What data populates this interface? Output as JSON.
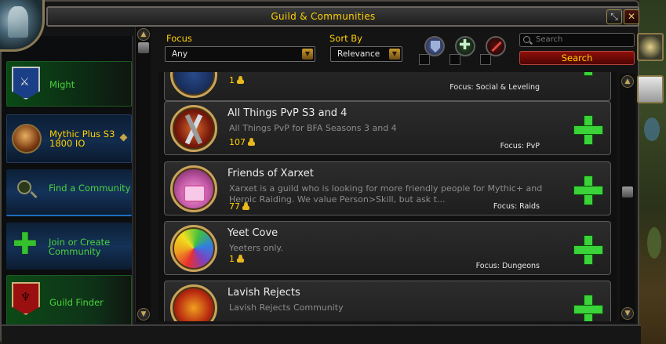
{
  "window": {
    "title": "Guild & Communities"
  },
  "sidebar": {
    "items": [
      {
        "label": "Might",
        "color": "#4bd33b"
      },
      {
        "label": "Mythic Plus S3",
        "sub": "1800 IO",
        "color": "#ffd100"
      },
      {
        "label": "Find a Community",
        "color": "#4bd33b"
      },
      {
        "label": "Join or Create Community",
        "color": "#4bd33b"
      },
      {
        "label": "Guild Finder",
        "color": "#4bd33b"
      }
    ]
  },
  "filters": {
    "focus_label": "Focus",
    "focus_value": "Any",
    "sort_label": "Sort By",
    "sort_value": "Relevance",
    "search_placeholder": "Search",
    "search_button": "Search",
    "roles": [
      "tank-icon",
      "healer-icon",
      "damage-icon"
    ]
  },
  "results": [
    {
      "name": "",
      "desc": "",
      "members": "1",
      "focus": "Focus: Social & Leveling"
    },
    {
      "name": "All Things PvP S3 and 4",
      "desc": "All Things PvP for BFA Seasons 3 and 4",
      "members": "107",
      "focus": "Focus: PvP"
    },
    {
      "name": "Friends of Xarxet",
      "desc": "Xarxet is a guild who is looking for more friendly people for Mythic+ and Heroic Raiding. We value Person>Skill, but ask t...",
      "members": "77",
      "focus": "Focus: Raids"
    },
    {
      "name": "Yeet Cove",
      "desc": "Yeeters only.",
      "members": "1",
      "focus": "Focus: Dungeons"
    },
    {
      "name": "Lavish Rejects",
      "desc": "Lavish Rejects Community",
      "members": "",
      "focus": ""
    }
  ],
  "colors": {
    "accent_gold": "#ffd100",
    "accent_green": "#3ad33a",
    "search_red": "#8e0f0a"
  }
}
